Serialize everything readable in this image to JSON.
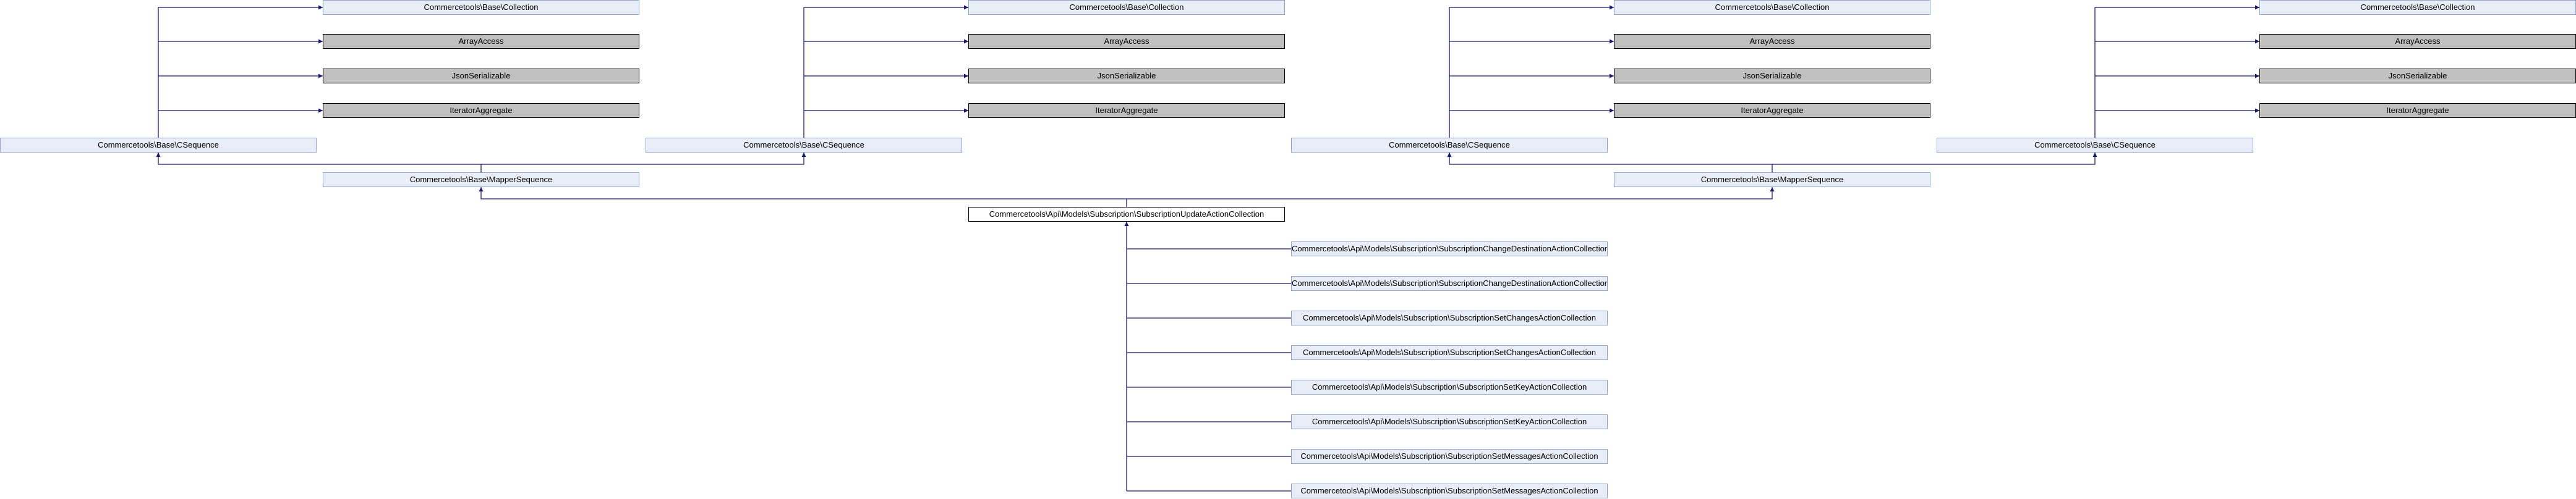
{
  "diagram": {
    "main_class": "Commercetools\\Api\\Models\\Subscription\\SubscriptionUpdateActionCollection",
    "mapper_sequence": "Commercetools\\Base\\MapperSequence",
    "csequence": "Commercetools\\Base\\CSequence",
    "collection": "Commercetools\\Base\\Collection",
    "array_access": "ArrayAccess",
    "json_serializable": "JsonSerializable",
    "iterator_aggregate": "IteratorAggregate",
    "children": [
      "Commercetools\\Api\\Models\\Subscription\\SubscriptionChangeDestinationActionCollection",
      "Commercetools\\Api\\Models\\Subscription\\SubscriptionChangeDestinationActionCollection",
      "Commercetools\\Api\\Models\\Subscription\\SubscriptionSetChangesActionCollection",
      "Commercetools\\Api\\Models\\Subscription\\SubscriptionSetChangesActionCollection",
      "Commercetools\\Api\\Models\\Subscription\\SubscriptionSetKeyActionCollection",
      "Commercetools\\Api\\Models\\Subscription\\SubscriptionSetKeyActionCollection",
      "Commercetools\\Api\\Models\\Subscription\\SubscriptionSetMessagesActionCollection",
      "Commercetools\\Api\\Models\\Subscription\\SubscriptionSetMessagesActionCollection"
    ]
  },
  "colors": {
    "edge": "#191970",
    "node_fill": "#e8edf8",
    "node_border": "#8fa3d4",
    "external_fill": "#c0c0c0",
    "main_fill": "#ffffff"
  }
}
